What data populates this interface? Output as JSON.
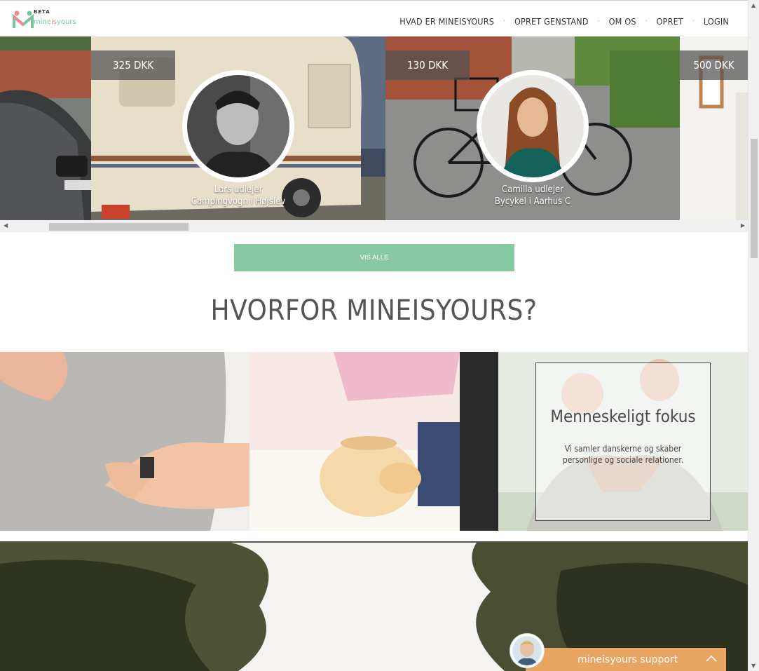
{
  "header": {
    "logo": {
      "beta": "BETA",
      "word_part1": "mine",
      "word_part2": "is",
      "word_part3": "yours"
    },
    "nav": [
      "HVAD ER MINEISYOURS",
      "OPRET GENSTAND",
      "OM OS",
      "OPRET",
      "LOGIN"
    ],
    "nav_separator": "·"
  },
  "carousel": {
    "items": [
      {
        "price": "",
        "owner_line": "",
        "item_line": ""
      },
      {
        "price": "325 DKK",
        "owner_line": "Lars udlejer",
        "item_line": "Campingvogn i Højslev"
      },
      {
        "price": "130 DKK",
        "owner_line": "Camilla udlejer",
        "item_line": "Bycykel i Aarhus C"
      },
      {
        "price": "500 DKK",
        "owner_line": "",
        "item_line": ""
      }
    ]
  },
  "cta": {
    "label": "VIS ALLE"
  },
  "why": {
    "title": "HVORFOR MINEISYOURS?",
    "feature": {
      "title": "Menneskeligt fokus",
      "text": "Vi samler danskerne og skaber personlige og sociale relationer."
    }
  },
  "support": {
    "label": "mineisyours support"
  },
  "colors": {
    "accent": "#86c9a2",
    "support": "#e8a561",
    "logo_pink": "#f08a8a"
  }
}
